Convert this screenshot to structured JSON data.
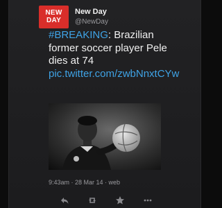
{
  "account": {
    "avatar_line1": "NEW",
    "avatar_line2": "DAY",
    "name": "New Day",
    "handle": "@NewDay"
  },
  "tweet": {
    "hashtag": "#BREAKING",
    "text": ": Brazilian former soccer player Pele dies at 74",
    "link": "pic.twitter.com/zwbNnxtCYw"
  },
  "meta": {
    "timestamp": "9:43am · 28 Mar 14 · web"
  },
  "actions": [
    {
      "name": "reply",
      "icon": "reply-icon"
    },
    {
      "name": "retweet",
      "icon": "retweet-icon"
    },
    {
      "name": "favorite",
      "icon": "star-icon"
    },
    {
      "name": "more",
      "icon": "more-icon"
    }
  ],
  "colors": {
    "background": "#0c0c0c",
    "card": "#1f1f21",
    "brand": "#d92e2a",
    "link": "#3fa3e6",
    "text": "#f0f0f0",
    "muted": "#9a9a9e"
  }
}
